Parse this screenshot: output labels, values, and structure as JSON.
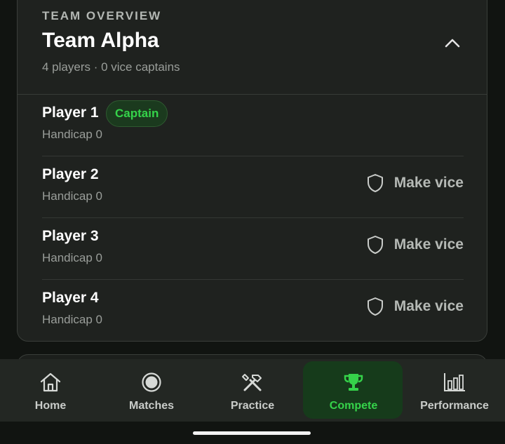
{
  "team_card": {
    "overline": "TEAM OVERVIEW",
    "title": "Team Alpha",
    "subtitle": "4 players · 0 vice captains",
    "collapse_icon": "chevron-up-icon"
  },
  "players": [
    {
      "name": "Player 1",
      "handicap": "Handicap 0",
      "badge": "Captain"
    },
    {
      "name": "Player 2",
      "handicap": "Handicap 0",
      "action": "Make vice"
    },
    {
      "name": "Player 3",
      "handicap": "Handicap 0",
      "action": "Make vice"
    },
    {
      "name": "Player 4",
      "handicap": "Handicap 0",
      "action": "Make vice"
    }
  ],
  "bottom_nav": {
    "items": [
      {
        "label": "Home",
        "icon": "home-icon"
      },
      {
        "label": "Matches",
        "icon": "matches-icon"
      },
      {
        "label": "Practice",
        "icon": "tools-icon"
      },
      {
        "label": "Compete",
        "icon": "trophy-icon",
        "active": true
      },
      {
        "label": "Performance",
        "icon": "bar-chart-icon"
      }
    ]
  },
  "colors": {
    "accent": "#35d34a",
    "background": "#111411",
    "card": "#1f221f",
    "nav_bg": "#232723"
  }
}
